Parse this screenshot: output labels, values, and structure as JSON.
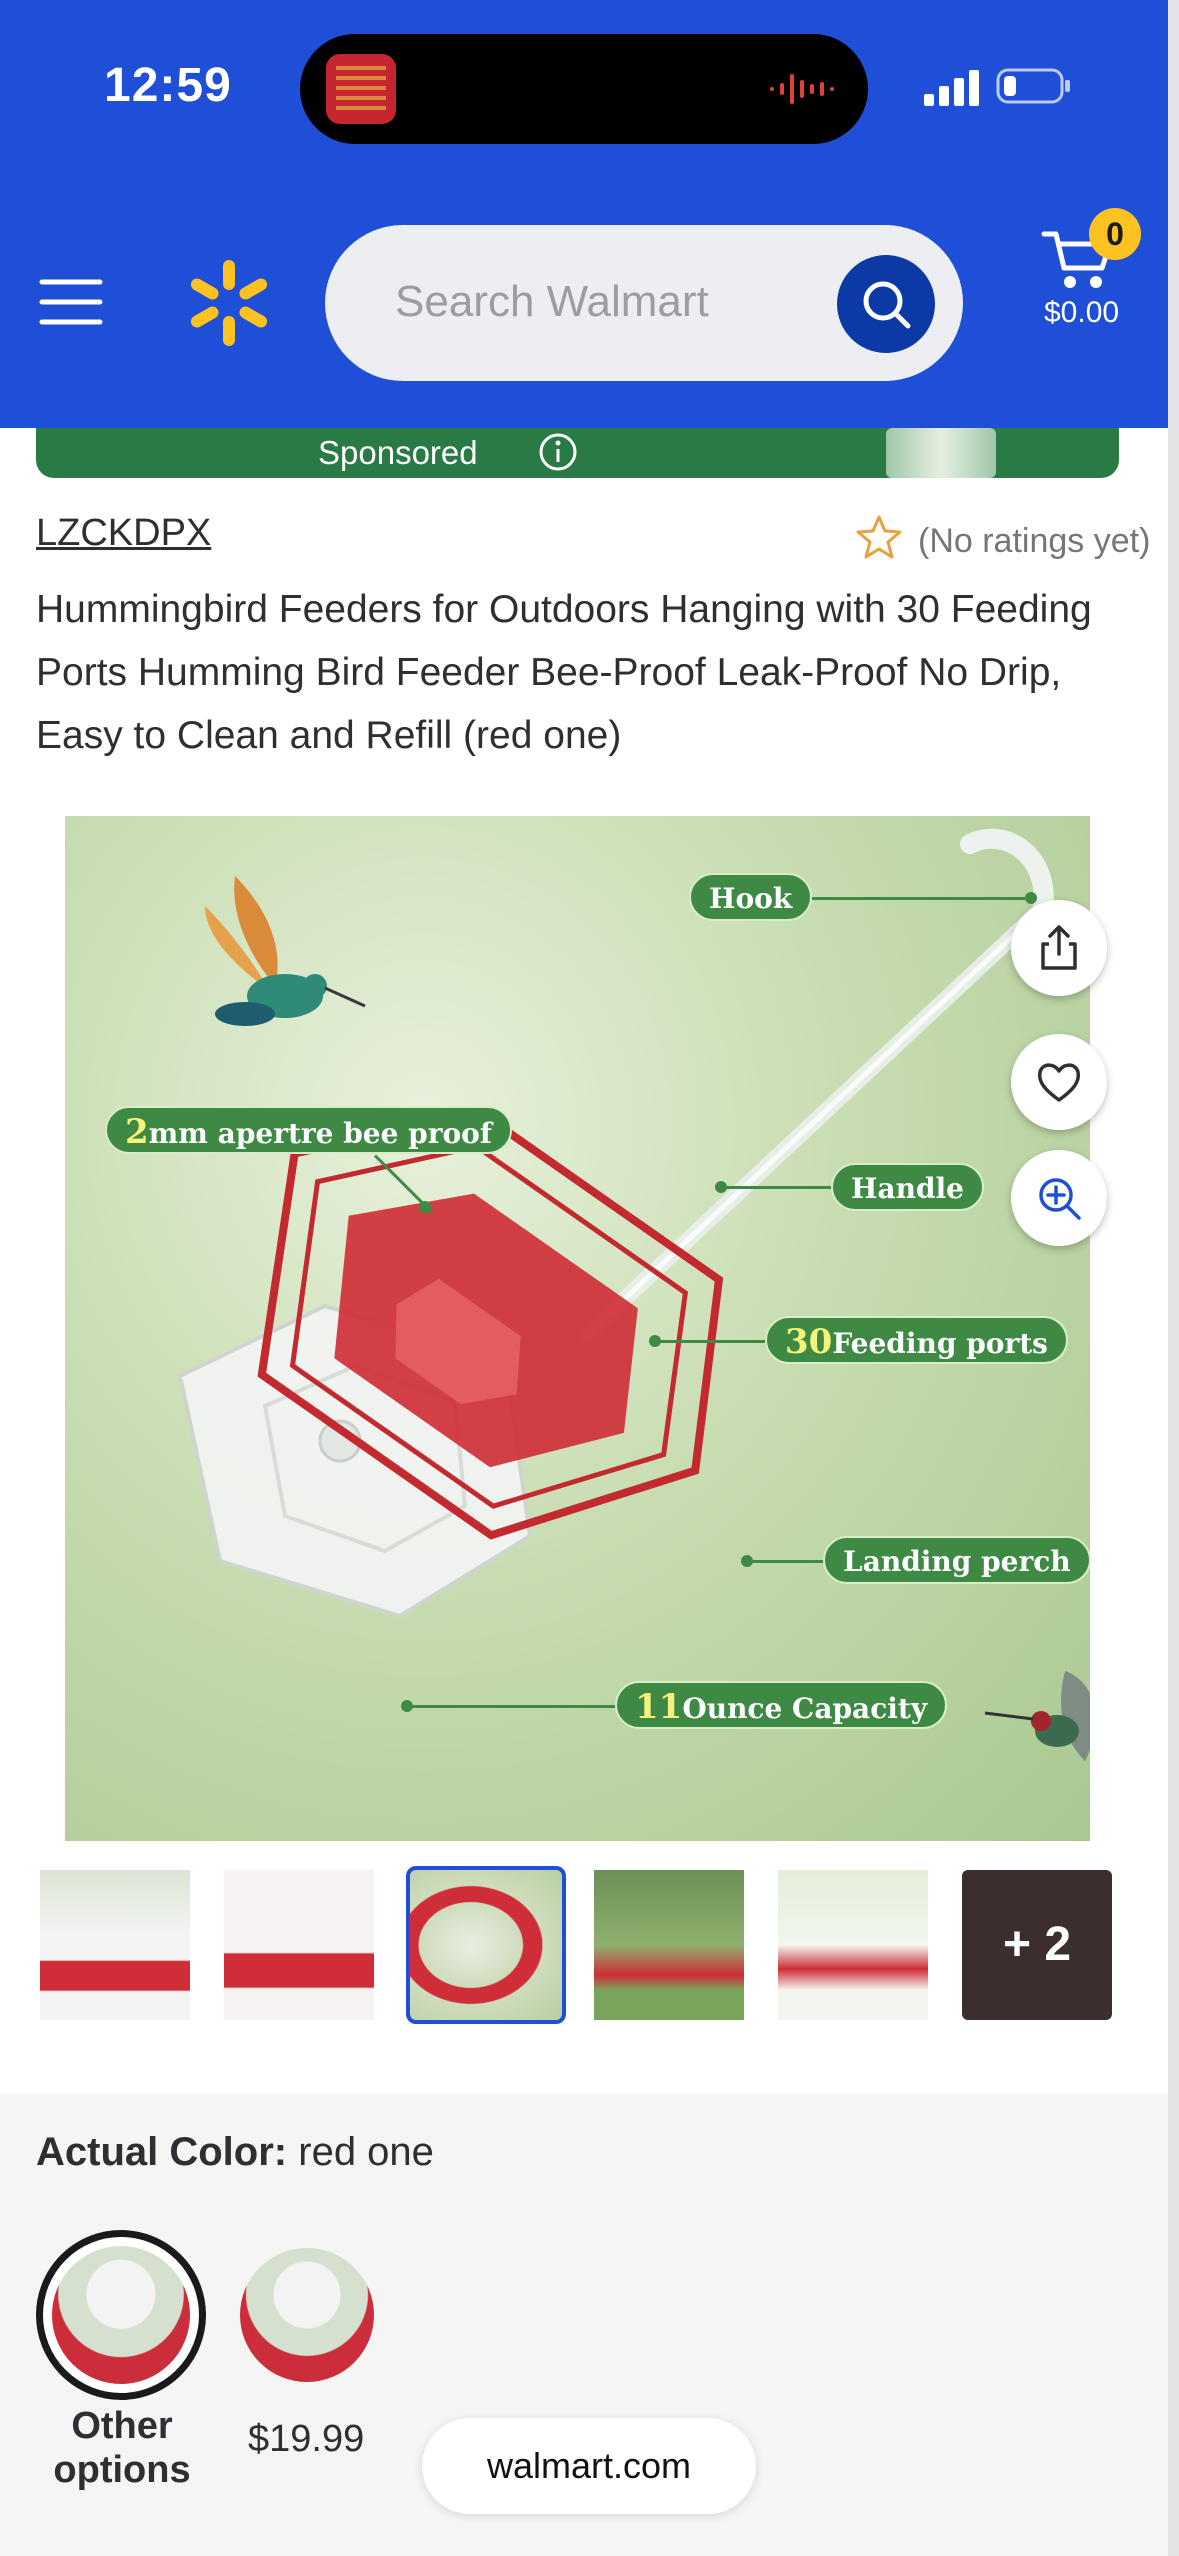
{
  "status_bar": {
    "time": "12:59"
  },
  "header": {
    "search_placeholder": "Search Walmart",
    "cart_count": "0",
    "cart_total": "$0.00",
    "accent_color": "#1f4fd6",
    "spark_color": "#ffc220"
  },
  "sponsored": {
    "label": "Sponsored"
  },
  "product": {
    "brand": "LZCKDPX",
    "ratings": "(No ratings yet)",
    "title": "Hummingbird Feeders for Outdoors Hanging with 30 Feeding Ports Humming Bird Feeder Bee-Proof Leak-Proof No Drip, Easy to Clean and Refill (red one)"
  },
  "image_callouts": {
    "hook": "Hook",
    "bee_proof_num": "2",
    "bee_proof": "mm apertre bee proof",
    "handle": "Handle",
    "ports_num": "30",
    "ports": "Feeding ports",
    "perch": "Landing perch",
    "capacity_num": "11",
    "capacity": "Ounce Capacity"
  },
  "thumbnails": {
    "more_label": "+ 2",
    "selected_index": 2
  },
  "variant": {
    "label": "Actual Color:",
    "value": "red one",
    "option1_label": "Other options",
    "option2_price": "$19.99"
  },
  "browser": {
    "url": "walmart.com"
  }
}
